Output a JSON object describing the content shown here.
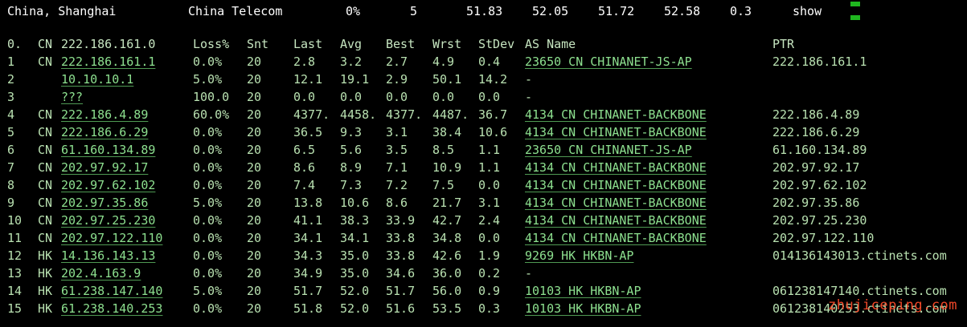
{
  "summary": {
    "location": "China, Shanghai",
    "isp": "China Telecom",
    "loss": "0%",
    "snt": "5",
    "last": "51.83",
    "avg": "52.05",
    "best": "51.72",
    "wrst": "52.58",
    "stdev": "0.3",
    "show_label": "show"
  },
  "table": {
    "headers": {
      "idx": "0.",
      "cc": "CN",
      "host": "222.186.161.0",
      "loss": "Loss%",
      "snt": "Snt",
      "last": "Last",
      "avg": "Avg",
      "best": "Best",
      "wrst": "Wrst",
      "stdev": "StDev",
      "as": "AS Name",
      "ptr": "PTR"
    },
    "rows": [
      {
        "idx": "1",
        "cc": "CN",
        "host": "222.186.161.1",
        "loss": "0.0%",
        "snt": "20",
        "last": "2.8",
        "avg": "3.2",
        "best": "2.7",
        "wrst": "4.9",
        "stdev": "0.4",
        "as": "23650 CN CHINANET-JS-AP",
        "ptr": "222.186.161.1"
      },
      {
        "idx": "2",
        "cc": "",
        "host": "10.10.10.1",
        "loss": "5.0%",
        "snt": "20",
        "last": "12.1",
        "avg": "19.1",
        "best": "2.9",
        "wrst": "50.1",
        "stdev": "14.2",
        "as": "-",
        "ptr": ""
      },
      {
        "idx": "3",
        "cc": "",
        "host": "???",
        "loss": "100.0",
        "snt": "20",
        "last": "0.0",
        "avg": "0.0",
        "best": "0.0",
        "wrst": "0.0",
        "stdev": "0.0",
        "as": "-",
        "ptr": ""
      },
      {
        "idx": "4",
        "cc": "CN",
        "host": "222.186.4.89",
        "loss": "60.0%",
        "snt": "20",
        "last": "4377.",
        "avg": "4458.",
        "best": "4377.",
        "wrst": "4487.",
        "stdev": "36.7",
        "as": "4134  CN CHINANET-BACKBONE",
        "ptr": "222.186.4.89"
      },
      {
        "idx": "5",
        "cc": "CN",
        "host": "222.186.6.29",
        "loss": "0.0%",
        "snt": "20",
        "last": "36.5",
        "avg": "9.3",
        "best": "3.1",
        "wrst": "38.4",
        "stdev": "10.6",
        "as": "4134  CN CHINANET-BACKBONE",
        "ptr": "222.186.6.29"
      },
      {
        "idx": "6",
        "cc": "CN",
        "host": "61.160.134.89",
        "loss": "0.0%",
        "snt": "20",
        "last": "6.5",
        "avg": "5.6",
        "best": "3.5",
        "wrst": "8.5",
        "stdev": "1.1",
        "as": "23650 CN CHINANET-JS-AP",
        "ptr": "61.160.134.89"
      },
      {
        "idx": "7",
        "cc": "CN",
        "host": "202.97.92.17",
        "loss": "0.0%",
        "snt": "20",
        "last": "8.6",
        "avg": "8.9",
        "best": "7.1",
        "wrst": "10.9",
        "stdev": "1.1",
        "as": "4134  CN CHINANET-BACKBONE",
        "ptr": "202.97.92.17"
      },
      {
        "idx": "8",
        "cc": "CN",
        "host": "202.97.62.102",
        "loss": "0.0%",
        "snt": "20",
        "last": "7.4",
        "avg": "7.3",
        "best": "7.2",
        "wrst": "7.5",
        "stdev": "0.0",
        "as": "4134  CN CHINANET-BACKBONE",
        "ptr": "202.97.62.102"
      },
      {
        "idx": "9",
        "cc": "CN",
        "host": "202.97.35.86",
        "loss": "5.0%",
        "snt": "20",
        "last": "13.8",
        "avg": "10.6",
        "best": "8.6",
        "wrst": "21.7",
        "stdev": "3.1",
        "as": "4134  CN CHINANET-BACKBONE",
        "ptr": "202.97.35.86"
      },
      {
        "idx": "10",
        "cc": "CN",
        "host": "202.97.25.230",
        "loss": "0.0%",
        "snt": "20",
        "last": "41.1",
        "avg": "38.3",
        "best": "33.9",
        "wrst": "42.7",
        "stdev": "2.4",
        "as": "4134  CN CHINANET-BACKBONE",
        "ptr": "202.97.25.230"
      },
      {
        "idx": "11",
        "cc": "CN",
        "host": "202.97.122.110",
        "loss": "0.0%",
        "snt": "20",
        "last": "34.1",
        "avg": "34.1",
        "best": "33.8",
        "wrst": "34.8",
        "stdev": "0.0",
        "as": "4134  CN CHINANET-BACKBONE",
        "ptr": "202.97.122.110"
      },
      {
        "idx": "12",
        "cc": "HK",
        "host": "14.136.143.13",
        "loss": "0.0%",
        "snt": "20",
        "last": "34.3",
        "avg": "35.0",
        "best": "33.8",
        "wrst": "42.6",
        "stdev": "1.9",
        "as": "9269  HK HKBN-AP",
        "ptr": "014136143013.ctinets.com"
      },
      {
        "idx": "13",
        "cc": "HK",
        "host": "202.4.163.9",
        "loss": "0.0%",
        "snt": "20",
        "last": "34.9",
        "avg": "35.0",
        "best": "34.6",
        "wrst": "36.0",
        "stdev": "0.2",
        "as": "-",
        "ptr": ""
      },
      {
        "idx": "14",
        "cc": "HK",
        "host": "61.238.147.140",
        "loss": "5.0%",
        "snt": "20",
        "last": "51.7",
        "avg": "52.0",
        "best": "51.7",
        "wrst": "56.0",
        "stdev": "0.9",
        "as": "10103 HK HKBN-AP",
        "ptr": "061238147140.ctinets.com"
      },
      {
        "idx": "15",
        "cc": "HK",
        "host": "61.238.140.253",
        "loss": "0.0%",
        "snt": "20",
        "last": "51.8",
        "avg": "52.0",
        "best": "51.6",
        "wrst": "53.5",
        "stdev": "0.3",
        "as": "10103 HK HKBN-AP",
        "ptr": "061238140253.ctinets.com"
      }
    ]
  },
  "watermark": "zhujiceping.com",
  "colors": {
    "background": "#000000",
    "text": "#b8e0b0",
    "link": "#8de08f",
    "show": "#2ea043",
    "watermark": "#ff4c2b"
  }
}
